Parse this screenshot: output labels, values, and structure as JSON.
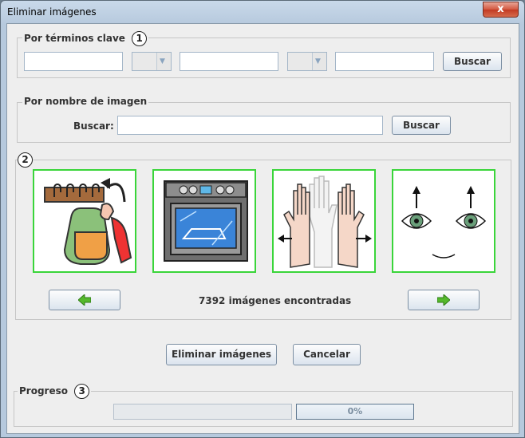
{
  "window": {
    "title": "Eliminar imágenes",
    "close_label": "x"
  },
  "keyword_search": {
    "legend": "Por términos clave",
    "badge": "1",
    "search_button": "Buscar"
  },
  "name_search": {
    "legend": "Por nombre de imagen",
    "label": "Buscar:",
    "search_button": "Buscar"
  },
  "results": {
    "badge": "2",
    "count_text": "7392 imágenes encontradas",
    "images": [
      "backpack-hook-image",
      "oven-image",
      "hands-image",
      "eyes-face-image"
    ]
  },
  "actions": {
    "delete_button": "Eliminar imágenes",
    "cancel_button": "Cancelar"
  },
  "progress": {
    "legend": "Progreso",
    "badge": "3",
    "percent_text": "0%",
    "value": 0
  },
  "colors": {
    "thumb_border": "#3ad53a",
    "nav_arrow": "#55b92c"
  }
}
